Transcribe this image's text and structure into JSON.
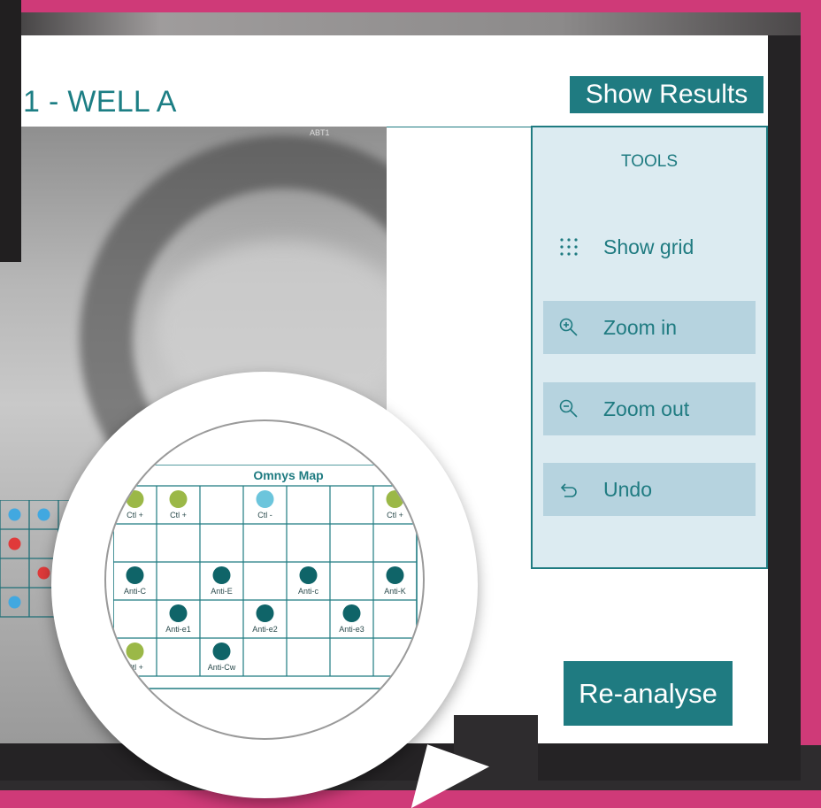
{
  "header": {
    "title": "1 - WELL A",
    "show_results_label": "Show Results"
  },
  "image": {
    "corner_label": "ABT1"
  },
  "tools": {
    "title": "TOOLS",
    "items": [
      {
        "label": "Show grid",
        "icon": "grid-dots-icon",
        "boxed": false
      },
      {
        "label": "Zoom in",
        "icon": "zoom-in-icon",
        "boxed": true
      },
      {
        "label": "Zoom out",
        "icon": "zoom-out-icon",
        "boxed": true
      },
      {
        "label": "Undo",
        "icon": "undo-icon",
        "boxed": true
      }
    ]
  },
  "reanalyse_label": "Re-analyse",
  "omnys_map": {
    "title": "Omnys Map",
    "rows": [
      [
        {
          "label": "Ctl +",
          "dot": "green"
        },
        {
          "label": "Ctl +",
          "dot": "green"
        },
        {
          "label": "",
          "dot": ""
        },
        {
          "label": "Ctl -",
          "dot": "blue"
        },
        {
          "label": "",
          "dot": ""
        },
        {
          "label": "",
          "dot": ""
        },
        {
          "label": "Ctl +",
          "dot": "green"
        }
      ],
      [
        {
          "label": "",
          "dot": ""
        },
        {
          "label": "",
          "dot": ""
        },
        {
          "label": "",
          "dot": ""
        },
        {
          "label": "",
          "dot": ""
        },
        {
          "label": "",
          "dot": ""
        },
        {
          "label": "",
          "dot": ""
        },
        {
          "label": "",
          "dot": ""
        }
      ],
      [
        {
          "label": "Anti-C",
          "dot": "teal"
        },
        {
          "label": "",
          "dot": ""
        },
        {
          "label": "Anti-E",
          "dot": "teal"
        },
        {
          "label": "",
          "dot": ""
        },
        {
          "label": "Anti-c",
          "dot": "teal"
        },
        {
          "label": "",
          "dot": ""
        },
        {
          "label": "Anti-K",
          "dot": "teal"
        }
      ],
      [
        {
          "label": "",
          "dot": ""
        },
        {
          "label": "Anti-e1",
          "dot": "teal"
        },
        {
          "label": "",
          "dot": ""
        },
        {
          "label": "Anti-e2",
          "dot": "teal"
        },
        {
          "label": "",
          "dot": ""
        },
        {
          "label": "Anti-e3",
          "dot": "teal"
        },
        {
          "label": "",
          "dot": ""
        }
      ],
      [
        {
          "label": "Ctl +",
          "dot": "green"
        },
        {
          "label": "",
          "dot": ""
        },
        {
          "label": "Anti-Cw",
          "dot": "teal"
        },
        {
          "label": "",
          "dot": ""
        },
        {
          "label": "",
          "dot": ""
        },
        {
          "label": "",
          "dot": ""
        },
        {
          "label": "",
          "dot": ""
        }
      ]
    ]
  },
  "colors": {
    "accent": "#1f7b81",
    "dot_green": "#9bb847",
    "dot_blue": "#6cc5dc",
    "dot_teal": "#0f6468",
    "dot_red": "#e03a3a",
    "background": "#cf3a78"
  },
  "overlay_dots": [
    {
      "row": 0,
      "col": 0,
      "color": "blue"
    },
    {
      "row": 0,
      "col": 1,
      "color": "blue"
    },
    {
      "row": 0,
      "col": 4,
      "color": "blue"
    },
    {
      "row": 1,
      "col": 0,
      "color": "red"
    },
    {
      "row": 1,
      "col": 2,
      "color": "green"
    },
    {
      "row": 2,
      "col": 1,
      "color": "red"
    },
    {
      "row": 2,
      "col": 3,
      "color": "green"
    },
    {
      "row": 3,
      "col": 0,
      "color": "blue"
    },
    {
      "row": 3,
      "col": 2,
      "color": "green"
    }
  ]
}
